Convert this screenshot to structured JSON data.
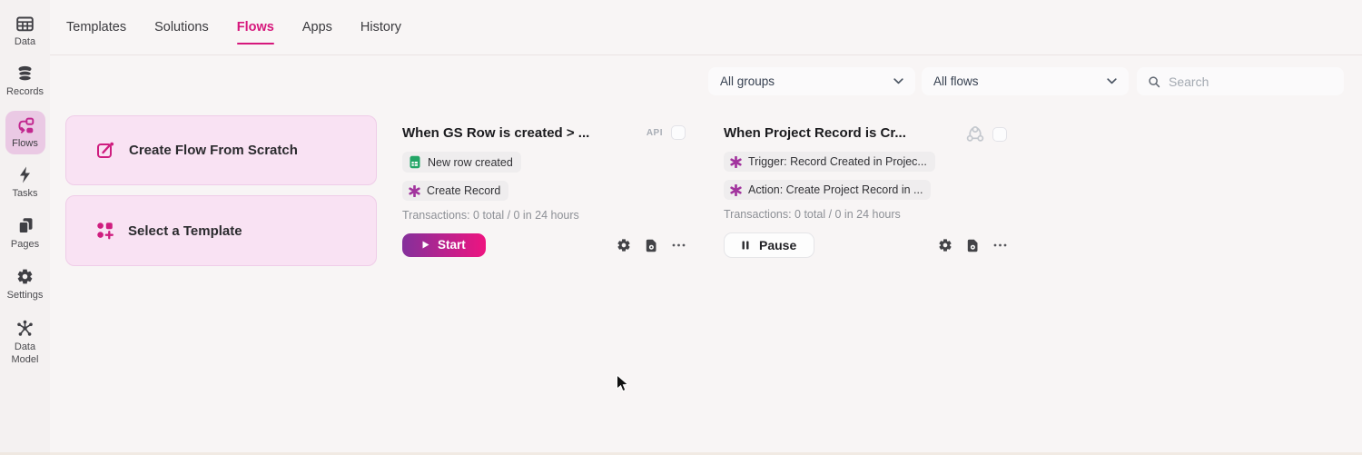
{
  "sidebar": {
    "items": [
      {
        "label": "Data"
      },
      {
        "label": "Records"
      },
      {
        "label": "Flows",
        "active": true
      },
      {
        "label": "Tasks"
      },
      {
        "label": "Pages"
      },
      {
        "label": "Settings"
      },
      {
        "label": "Data Model"
      }
    ]
  },
  "nav": {
    "items": [
      "Templates",
      "Solutions",
      "Flows",
      "Apps",
      "History"
    ],
    "active": "Flows"
  },
  "filters": {
    "groups_value": "All groups",
    "flows_value": "All flows",
    "search_placeholder": "Search"
  },
  "quick_actions": {
    "create_flow": "Create Flow From Scratch",
    "select_template": "Select a Template"
  },
  "cards": [
    {
      "title": "When GS Row is created > ...",
      "api_label": "API",
      "pills": [
        {
          "icon": "spreadsheet-green",
          "label": "New row created"
        },
        {
          "icon": "asterisk-purple",
          "label": "Create Record"
        }
      ],
      "transactions": "Transactions: 0 total / 0 in 24 hours",
      "primary_action": "Start"
    },
    {
      "title": "When Project Record is Cr...",
      "pills": [
        {
          "icon": "asterisk-purple",
          "label": "Trigger: Record Created in Projec..."
        },
        {
          "icon": "asterisk-purple",
          "label": "Action: Create Project Record in ..."
        }
      ],
      "transactions": "Transactions: 0 total / 0 in 24 hours",
      "primary_action": "Pause"
    }
  ],
  "colors": {
    "accent_pink": "#d6177c",
    "start_gradient_from": "#84309b",
    "start_gradient_to": "#ee1480",
    "flows_active_bg": "#eac9e4",
    "action_card_bg": "#f9e2f3",
    "pill_bg": "#efedee",
    "sheet_green": "#23a566",
    "asterisk_purple": "#a2349e"
  }
}
